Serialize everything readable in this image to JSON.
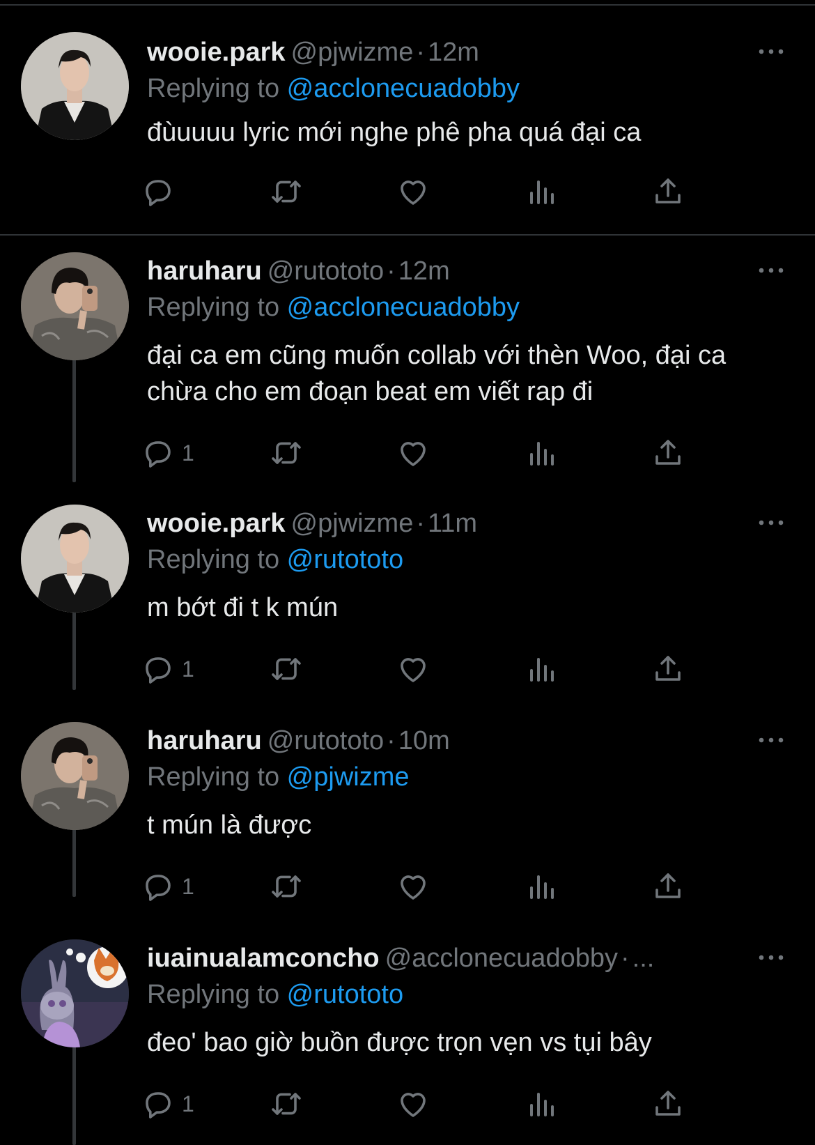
{
  "tweets": [
    {
      "name": "wooie.park",
      "handle": "@pjwizme",
      "separator": "·",
      "time": "12m",
      "replying_prefix": "Replying to ",
      "replying_to": "@acclonecuadobby",
      "text": "đùuuuu lyric mới nghe phê pha quá đại ca",
      "reply_count": "",
      "avatar": "avatar-man-leather-jacket"
    },
    {
      "name": "haruharu",
      "handle": "@rutototo",
      "separator": "·",
      "time": "12m",
      "replying_prefix": "Replying to ",
      "replying_to": "@acclonecuadobby",
      "text": "đại ca em cũng muốn collab với thèn Woo, đại ca chừa cho em đoạn beat em viết rap đi",
      "reply_count": "1",
      "avatar": "avatar-mirror-selfie"
    },
    {
      "name": "wooie.park",
      "handle": "@pjwizme",
      "separator": "·",
      "time": "11m",
      "replying_prefix": "Replying to ",
      "replying_to": "@rutototo",
      "text": "m bớt đi t k mún",
      "reply_count": "1",
      "avatar": "avatar-man-leather-jacket"
    },
    {
      "name": "haruharu",
      "handle": "@rutototo",
      "separator": "·",
      "time": "10m",
      "replying_prefix": "Replying to ",
      "replying_to": "@pjwizme",
      "text": "t mún là được",
      "reply_count": "1",
      "avatar": "avatar-mirror-selfie"
    },
    {
      "name": "iuainualamconcho",
      "handle": "@acclonecuadobby",
      "separator": "·",
      "time": "...",
      "replying_prefix": "Replying to ",
      "replying_to": "@rutototo",
      "text": "đeo' bao giờ buồn được trọn vẹn vs tụi bây",
      "reply_count": "1",
      "avatar": "avatar-cartoon-bunny-fox"
    }
  ],
  "icons": {
    "reply": "reply-icon",
    "retweet": "retweet-icon",
    "like": "heart-icon",
    "views": "views-icon",
    "share": "share-icon",
    "more": "more-icon"
  },
  "colors": {
    "background": "#000000",
    "text": "#e7e9ea",
    "muted": "#71767b",
    "link": "#1d9bf0",
    "divider": "#2f3336"
  }
}
